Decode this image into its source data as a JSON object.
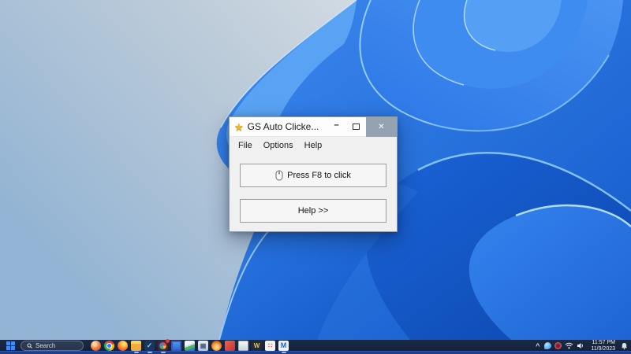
{
  "app_window": {
    "title": "GS Auto Clicke...",
    "menu": [
      "File",
      "Options",
      "Help"
    ],
    "primary_button_label": "Press F8 to click",
    "secondary_button_label": "Help >>",
    "titlebar": {
      "app_icon_glyph": "★",
      "minimize_glyph": "–",
      "close_glyph": "✕"
    }
  },
  "taskbar": {
    "search_label": "Search",
    "app_icons": [
      {
        "name": "people-app",
        "style": "people"
      },
      {
        "name": "chrome",
        "style": "chrome"
      },
      {
        "name": "firefox",
        "style": "firefox"
      },
      {
        "name": "file-explorer",
        "style": "folder",
        "running": true
      },
      {
        "name": "todo-check",
        "style": "check",
        "glyph": "✓",
        "running": true
      },
      {
        "name": "pie-chart-app",
        "style": "pie",
        "badge": true,
        "running": true
      },
      {
        "name": "tablet-device",
        "style": "tablet"
      },
      {
        "name": "photos",
        "style": "photos"
      },
      {
        "name": "calculator",
        "style": "calc",
        "glyph": "▦"
      },
      {
        "name": "flame-app",
        "style": "flame"
      },
      {
        "name": "red-app",
        "style": "redapp"
      },
      {
        "name": "document-app",
        "style": "doc"
      },
      {
        "name": "w-app",
        "style": "wapp",
        "glyph": "W"
      },
      {
        "name": "dots-app",
        "style": "dots",
        "glyph": "∷"
      },
      {
        "name": "m-app",
        "style": "mapp",
        "glyph": "M",
        "running": true
      }
    ],
    "tray": {
      "time": "11:57 PM",
      "date": "11/9/2023"
    }
  },
  "colors": {
    "taskbar_bg": "#16233d",
    "taskbar_bottom_strip": "#1e3d82",
    "bloom_blue_mid": "#2b7ae6",
    "bloom_blue_deep": "#0c50ba",
    "bloom_edge_highlight": "#9fd2fa",
    "close_button_bg": "#94a2b2",
    "window_bg": "#f0f0f0"
  }
}
